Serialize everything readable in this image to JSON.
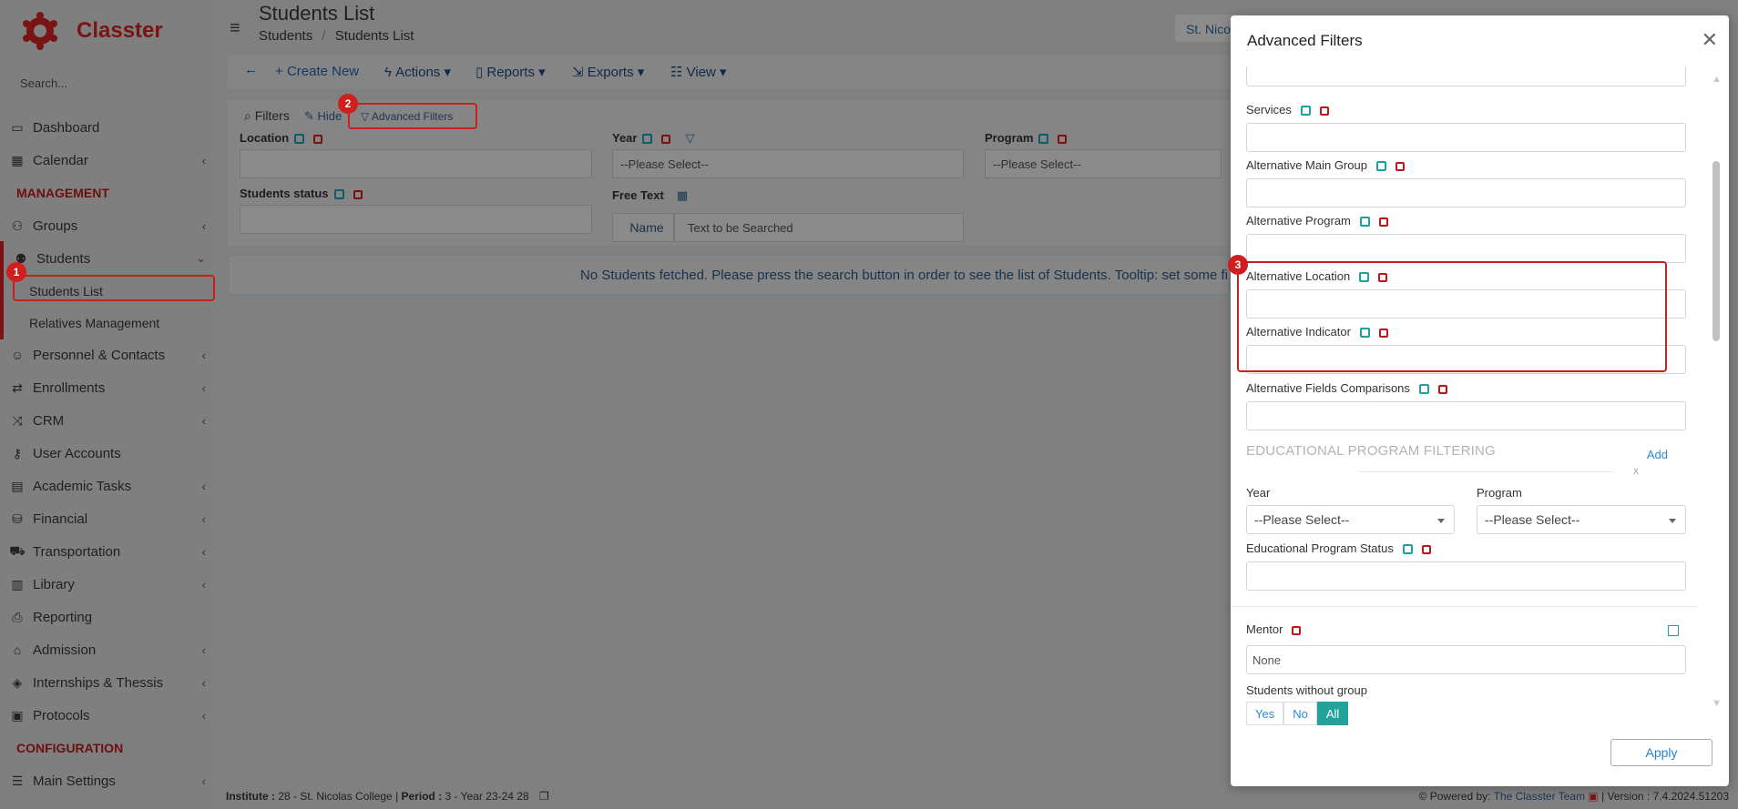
{
  "app": {
    "brand": "Classter",
    "search_placeholder": "Search..."
  },
  "sidebar": {
    "items": [
      {
        "label": "Dashboard",
        "icon": "monitor-icon",
        "chev": false
      },
      {
        "label": "Calendar",
        "icon": "calendar-icon",
        "chev": true
      }
    ],
    "management_label": "MANAGEMENT",
    "mgmt_items": [
      {
        "label": "Groups",
        "icon": "groups-icon"
      },
      {
        "label": "Students",
        "icon": "students-icon"
      }
    ],
    "students_sub": [
      "Students List",
      "Relatives Management"
    ],
    "more_items": [
      {
        "label": "Personnel & Contacts",
        "icon": "personnel-icon"
      },
      {
        "label": "Enrollments",
        "icon": "exchange-icon"
      },
      {
        "label": "CRM",
        "icon": "crm-icon"
      },
      {
        "label": "User Accounts",
        "icon": "key-icon"
      },
      {
        "label": "Academic Tasks",
        "icon": "tasks-icon"
      },
      {
        "label": "Financial",
        "icon": "coins-icon"
      },
      {
        "label": "Transportation",
        "icon": "bus-icon"
      },
      {
        "label": "Library",
        "icon": "books-icon"
      },
      {
        "label": "Reporting",
        "icon": "printer-icon"
      },
      {
        "label": "Admission",
        "icon": "building-icon"
      },
      {
        "label": "Internships & Thessis",
        "icon": "cube-icon"
      },
      {
        "label": "Protocols",
        "icon": "protocol-icon"
      }
    ],
    "configuration_label": "CONFIGURATION",
    "config_items": [
      {
        "label": "Main Settings",
        "icon": "sliders-icon"
      }
    ]
  },
  "header": {
    "title": "Students List",
    "breadcrumb": [
      "Students",
      "Students List"
    ],
    "institute_chip": "St. Nico"
  },
  "toolbar": {
    "create_new": "Create New",
    "actions": "Actions",
    "reports": "Reports",
    "exports": "Exports",
    "view": "View"
  },
  "filters": {
    "filters_label": "Filters",
    "hide_label": "Hide",
    "advanced_label": "Advanced Filters",
    "location_label": "Location",
    "year_label": "Year",
    "year_value": "--Please Select--",
    "program_label": "Program",
    "program_value": "--Please Select--",
    "status_label": "Students status",
    "freetext_label": "Free Text",
    "name_label": "Name",
    "freetext_placeholder": "Text to be Searched"
  },
  "message": "No Students fetched. Please press the search button in order to see the list of Students. Tooltip: set some filte",
  "badges": [
    "1",
    "2",
    "3"
  ],
  "modal": {
    "title": "Advanced Filters",
    "fields": [
      {
        "label": "Services"
      },
      {
        "label": "Alternative Main Group"
      },
      {
        "label": "Alternative Program"
      },
      {
        "label": "Alternative Location"
      },
      {
        "label": "Alternative Indicator"
      },
      {
        "label": "Alternative Fields Comparisons"
      }
    ],
    "edu_section": "EDUCATIONAL PROGRAM FILTERING",
    "add_label": "Add",
    "remove_label": "x",
    "year_label": "Year",
    "year_value": "--Please Select--",
    "program_label": "Program",
    "program_value": "--Please Select--",
    "edu_status_label": "Educational Program Status",
    "mentor_label": "Mentor",
    "mentor_value": "None",
    "without_group_label": "Students without group",
    "toggle": [
      "Yes",
      "No",
      "All"
    ],
    "toggle_selected": "All",
    "apply_label": "Apply"
  },
  "footer": {
    "institute_label": "Institute :",
    "institute_value": "28 - St. Nicolas College",
    "period_label": "Period :",
    "period_value": "3 - Year 23-24 28",
    "powered_by": "Powered by:",
    "team": "The Classter Team",
    "version": "| Version : 7.4.2024.51203"
  },
  "colors": {
    "brand": "#c8201e",
    "teal": "#22a39a",
    "link": "#2b8bd0"
  }
}
